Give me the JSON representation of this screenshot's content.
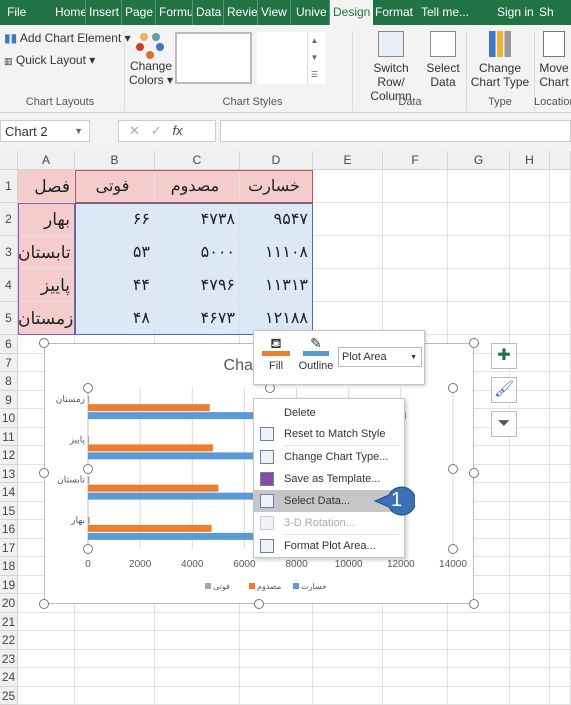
{
  "tabs": [
    "File",
    "Home",
    "Insert",
    "Page",
    "Formu",
    "Data",
    "Review",
    "View",
    "Unive",
    "Design",
    "Format",
    "Tell me...",
    "Sign in",
    "Sh"
  ],
  "ribbon": {
    "add_chart_element": "Add Chart Element",
    "quick_layout": "Quick Layout",
    "chart_layouts": "Chart Layouts",
    "change_colors_1": "Change",
    "change_colors_2": "Colors",
    "chart_styles": "Chart Styles",
    "switch_1": "Switch Row/",
    "switch_2": "Column",
    "select_1": "Select",
    "select_2": "Data",
    "data_group": "Data",
    "cct_1": "Change",
    "cct_2": "Chart Type",
    "type_group": "Type",
    "move_1": "Move",
    "move_2": "Chart",
    "location_group": "Location"
  },
  "formula_bar": {
    "name_box": "Chart 2",
    "fx": "fx",
    "value": ""
  },
  "columns": [
    "A",
    "B",
    "C",
    "D",
    "E",
    "F",
    "G",
    "H"
  ],
  "rows": [
    "1",
    "2",
    "3",
    "4",
    "5",
    "6",
    "7",
    "8",
    "9",
    "10",
    "11",
    "12",
    "13",
    "14",
    "15",
    "16",
    "17",
    "18",
    "19",
    "20",
    "21",
    "22",
    "23",
    "24",
    "25"
  ],
  "table": {
    "header": [
      "فصل",
      "خسارت",
      "مصدوم",
      "فوتی"
    ],
    "rows": [
      [
        "بهار",
        "۹۵۴۷",
        "۴۷۳۸",
        "۶۶"
      ],
      [
        "تابستان",
        "۱۱۱۰۸",
        "۵۰۰۰",
        "۵۳"
      ],
      [
        "پاییز",
        "۱۱۳۱۳",
        "۴۷۹۶",
        "۴۴"
      ],
      [
        "زمستان",
        "۱۲۱۸۸",
        "۴۶۷۳",
        "۴۸"
      ]
    ]
  },
  "chart_data": {
    "type": "bar",
    "orientation": "horizontal",
    "title": "Chart Title",
    "categories": [
      "بهار",
      "تابستان",
      "پاییز",
      "زمستان"
    ],
    "series": [
      {
        "name": "خسارت",
        "color": "#5b9bd5",
        "values": [
          9547,
          11108,
          11313,
          12188
        ]
      },
      {
        "name": "مصدوم",
        "color": "#ed7d31",
        "values": [
          4738,
          5000,
          4796,
          4673
        ]
      },
      {
        "name": "فوتی",
        "color": "#a5a5a5",
        "values": [
          66,
          53,
          44,
          48
        ]
      }
    ],
    "xlim": [
      0,
      14000
    ],
    "xticks": [
      "0",
      "2000",
      "4000",
      "6000",
      "8000",
      "10000",
      "12000",
      "14000"
    ],
    "grid": true,
    "legend": "bottom"
  },
  "mini_toolbar": {
    "fill": "Fill",
    "outline": "Outline",
    "selector": "Plot Area"
  },
  "context_menu": [
    {
      "label": "Delete",
      "icon": "none",
      "disabled": false
    },
    {
      "label": "Reset to Match Style",
      "icon": "reset-style-icon",
      "disabled": false
    },
    {
      "label": "Change Chart Type...",
      "icon": "chart-type-icon",
      "disabled": false
    },
    {
      "label": "Save as Template...",
      "icon": "template-icon",
      "disabled": false
    },
    {
      "label": "Select Data...",
      "icon": "select-data-icon",
      "disabled": false,
      "highlighted": true
    },
    {
      "label": "3-D Rotation...",
      "icon": "rotation-icon",
      "disabled": true
    },
    {
      "label": "Format Plot Area...",
      "icon": "format-icon",
      "disabled": false
    }
  ],
  "callout": "1",
  "colors": {
    "excel_green": "#217346",
    "header_fill": "#f4cccc",
    "data_fill": "#dde8f6",
    "callout": "#3b6fb6"
  }
}
